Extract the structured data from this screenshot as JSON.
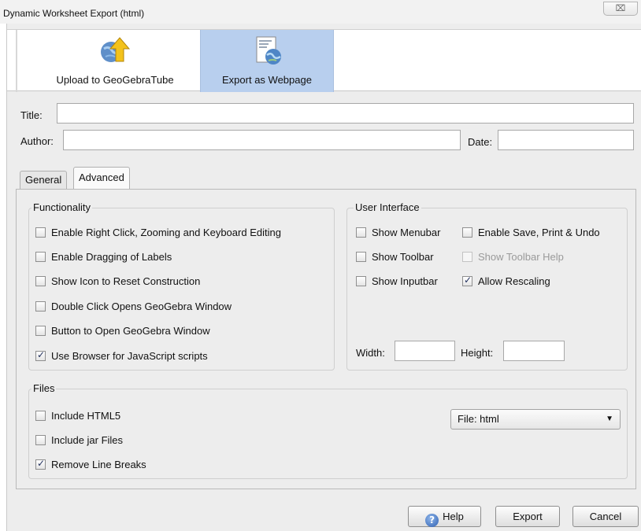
{
  "window": {
    "title": "Dynamic Worksheet Export (html)",
    "close_icon": "⌧"
  },
  "toolbar": {
    "upload_label": "Upload to GeoGebraTube",
    "export_label": "Export as Webpage"
  },
  "fields": {
    "title_label": "Title:",
    "title_value": "",
    "author_label": "Author:",
    "author_value": "",
    "date_label": "Date:",
    "date_value": ""
  },
  "tabs": {
    "general": "General",
    "advanced": "Advanced"
  },
  "functionality": {
    "title": "Functionality",
    "items": [
      {
        "label": "Enable Right Click, Zooming and Keyboard Editing",
        "checked": false
      },
      {
        "label": "Enable Dragging of Labels",
        "checked": false
      },
      {
        "label": "Show Icon to Reset Construction",
        "checked": false
      },
      {
        "label": "Double Click Opens GeoGebra Window",
        "checked": false
      },
      {
        "label": "Button to Open GeoGebra Window",
        "checked": false
      },
      {
        "label": "Use Browser for JavaScript scripts",
        "checked": true
      }
    ]
  },
  "ui": {
    "title": "User Interface",
    "items": [
      {
        "label": "Show Menubar",
        "checked": false
      },
      {
        "label": "Enable Save, Print & Undo",
        "checked": false
      },
      {
        "label": "Show Toolbar",
        "checked": false
      },
      {
        "label": "Show Toolbar Help",
        "checked": false,
        "disabled": true
      },
      {
        "label": "Show Inputbar",
        "checked": false
      },
      {
        "label": "Allow Rescaling",
        "checked": true
      }
    ],
    "width_label": "Width:",
    "width_value": "",
    "height_label": "Height:",
    "height_value": ""
  },
  "files": {
    "title": "Files",
    "items": [
      {
        "label": "Include HTML5",
        "checked": false
      },
      {
        "label": "Include jar Files",
        "checked": false
      },
      {
        "label": "Remove Line Breaks",
        "checked": true
      }
    ],
    "format_selected": "File: html"
  },
  "buttons": {
    "help": "Help",
    "export": "Export",
    "cancel": "Cancel"
  }
}
